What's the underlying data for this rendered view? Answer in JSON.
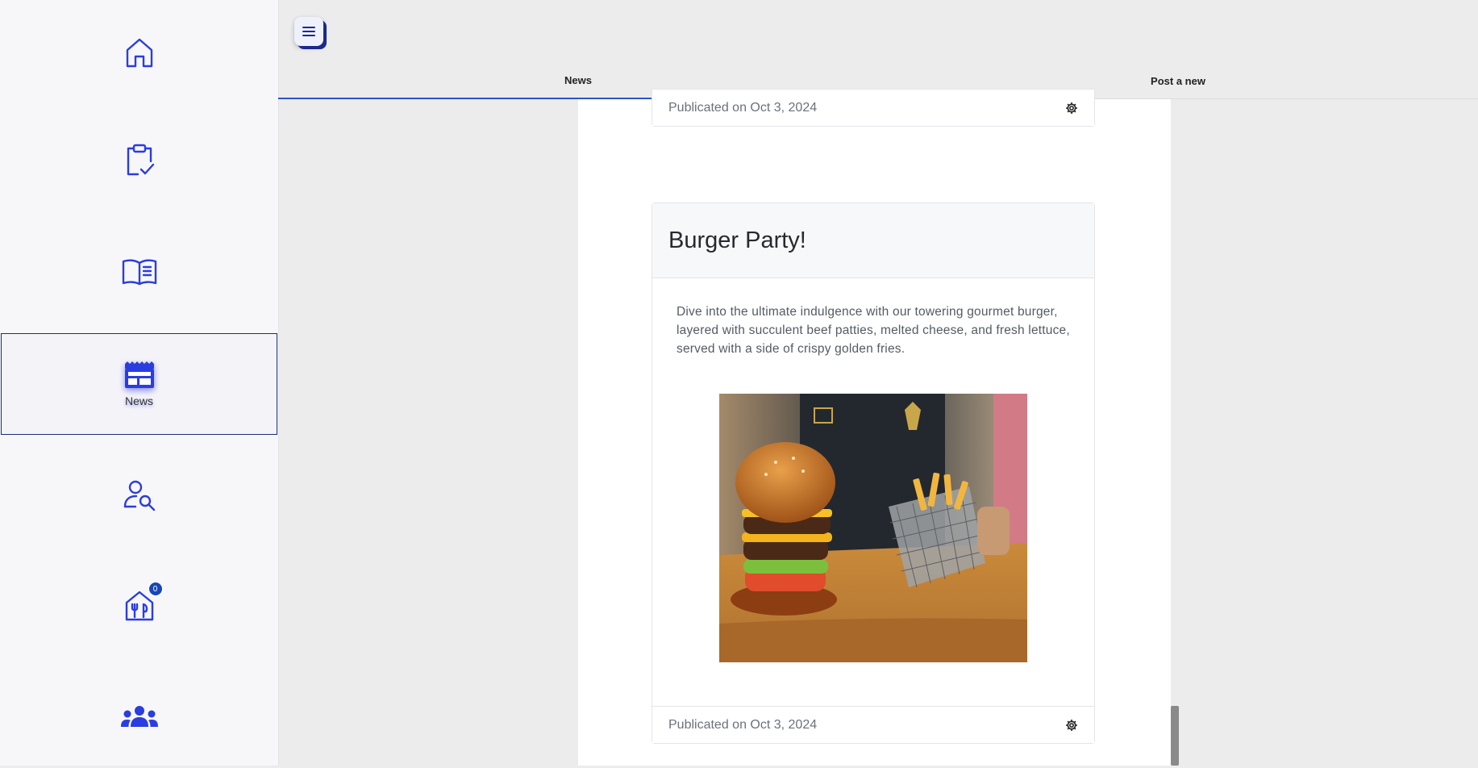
{
  "sidebar": {
    "items": [
      {
        "id": "home",
        "icon": "home-icon",
        "label": ""
      },
      {
        "id": "tasks",
        "icon": "clipboard-check-icon",
        "label": ""
      },
      {
        "id": "menu",
        "icon": "open-book-icon",
        "label": ""
      },
      {
        "id": "news",
        "icon": "newspaper-icon",
        "label": "News",
        "active": true
      },
      {
        "id": "search-user",
        "icon": "user-search-icon",
        "label": ""
      },
      {
        "id": "restaurant",
        "icon": "restaurant-house-icon",
        "label": "",
        "badge": "0"
      },
      {
        "id": "team",
        "icon": "group-icon",
        "label": ""
      }
    ]
  },
  "topbar": {
    "menu_icon": "hamburger-icon"
  },
  "tabs": [
    {
      "label": "News",
      "active": true
    },
    {
      "label": "Post a new",
      "active": false
    }
  ],
  "posts": [
    {
      "footer": "Publicated on Oct 3, 2024"
    },
    {
      "title": "Burger Party!",
      "body": "Dive into the ultimate indulgence with our towering gourmet burger, layered with succulent beef patties, melted cheese, and fresh lettuce, served with a side of crispy golden fries.",
      "footer": "Publicated on Oct 3, 2024",
      "image": "burger-and-fries-photo"
    }
  ],
  "colors": {
    "icon_blue": "#2a3de0",
    "accent": "#2b55c8",
    "badge": "#1746b8"
  }
}
